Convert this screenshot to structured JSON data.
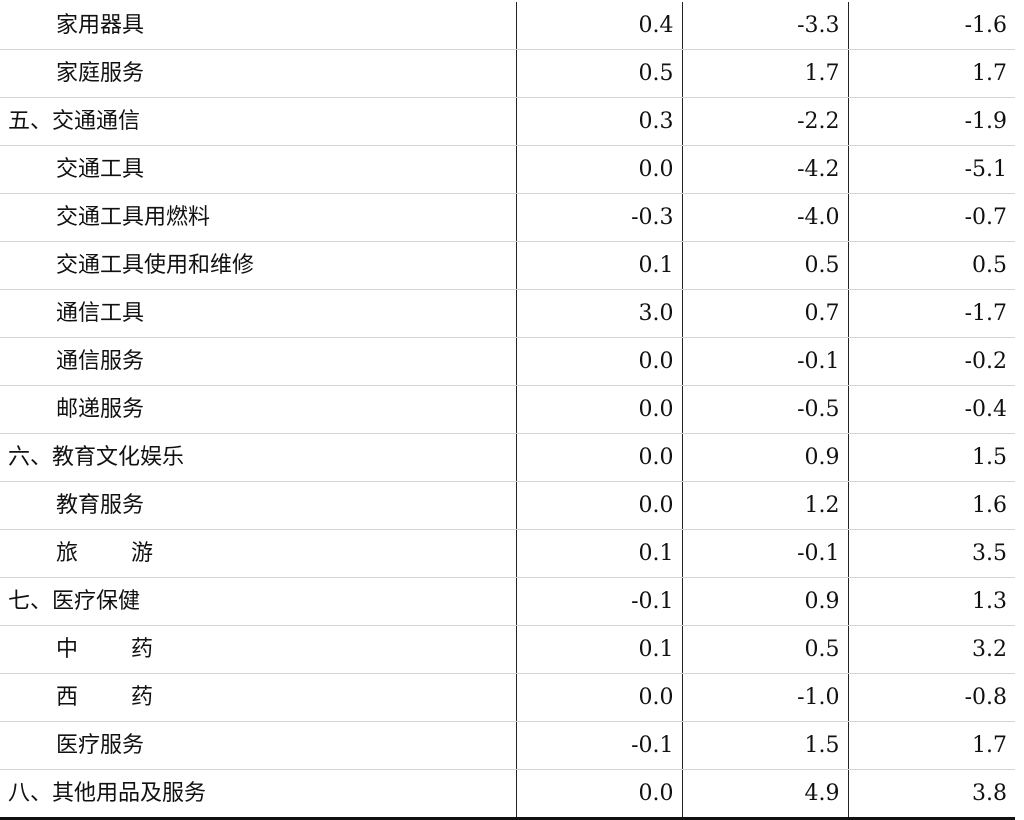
{
  "table": {
    "rows": [
      {
        "name": "家用器具",
        "level": 1,
        "v1": "0.4",
        "v2": "-3.3",
        "v3": "-1.6"
      },
      {
        "name": "家庭服务",
        "level": 1,
        "v1": "0.5",
        "v2": "1.7",
        "v3": "1.7"
      },
      {
        "name": "五、交通通信",
        "level": 0,
        "v1": "0.3",
        "v2": "-2.2",
        "v3": "-1.9"
      },
      {
        "name": "交通工具",
        "level": 1,
        "v1": "0.0",
        "v2": "-4.2",
        "v3": "-5.1"
      },
      {
        "name": "交通工具用燃料",
        "level": 1,
        "v1": "-0.3",
        "v2": "-4.0",
        "v3": "-0.7"
      },
      {
        "name": "交通工具使用和维修",
        "level": 1,
        "v1": "0.1",
        "v2": "0.5",
        "v3": "0.5"
      },
      {
        "name": "通信工具",
        "level": 1,
        "v1": "3.0",
        "v2": "0.7",
        "v3": "-1.7"
      },
      {
        "name": "通信服务",
        "level": 1,
        "v1": "0.0",
        "v2": "-0.1",
        "v3": "-0.2"
      },
      {
        "name": "邮递服务",
        "level": 1,
        "v1": "0.0",
        "v2": "-0.5",
        "v3": "-0.4"
      },
      {
        "name": "六、教育文化娱乐",
        "level": 0,
        "v1": "0.0",
        "v2": "0.9",
        "v3": "1.5"
      },
      {
        "name": "教育服务",
        "level": 1,
        "v1": "0.0",
        "v2": "1.2",
        "v3": "1.6"
      },
      {
        "name": "旅游",
        "level": 1,
        "spaced": true,
        "v1": "0.1",
        "v2": "-0.1",
        "v3": "3.5"
      },
      {
        "name": "七、医疗保健",
        "level": 0,
        "v1": "-0.1",
        "v2": "0.9",
        "v3": "1.3"
      },
      {
        "name": "中药",
        "level": 1,
        "spaced": true,
        "v1": "0.1",
        "v2": "0.5",
        "v3": "3.2"
      },
      {
        "name": "西药",
        "level": 1,
        "spaced": true,
        "v1": "0.0",
        "v2": "-1.0",
        "v3": "-0.8"
      },
      {
        "name": "医疗服务",
        "level": 1,
        "v1": "-0.1",
        "v2": "1.5",
        "v3": "1.7"
      },
      {
        "name": "八、其他用品及服务",
        "level": 0,
        "v1": "0.0",
        "v2": "4.9",
        "v3": "3.8"
      }
    ]
  }
}
